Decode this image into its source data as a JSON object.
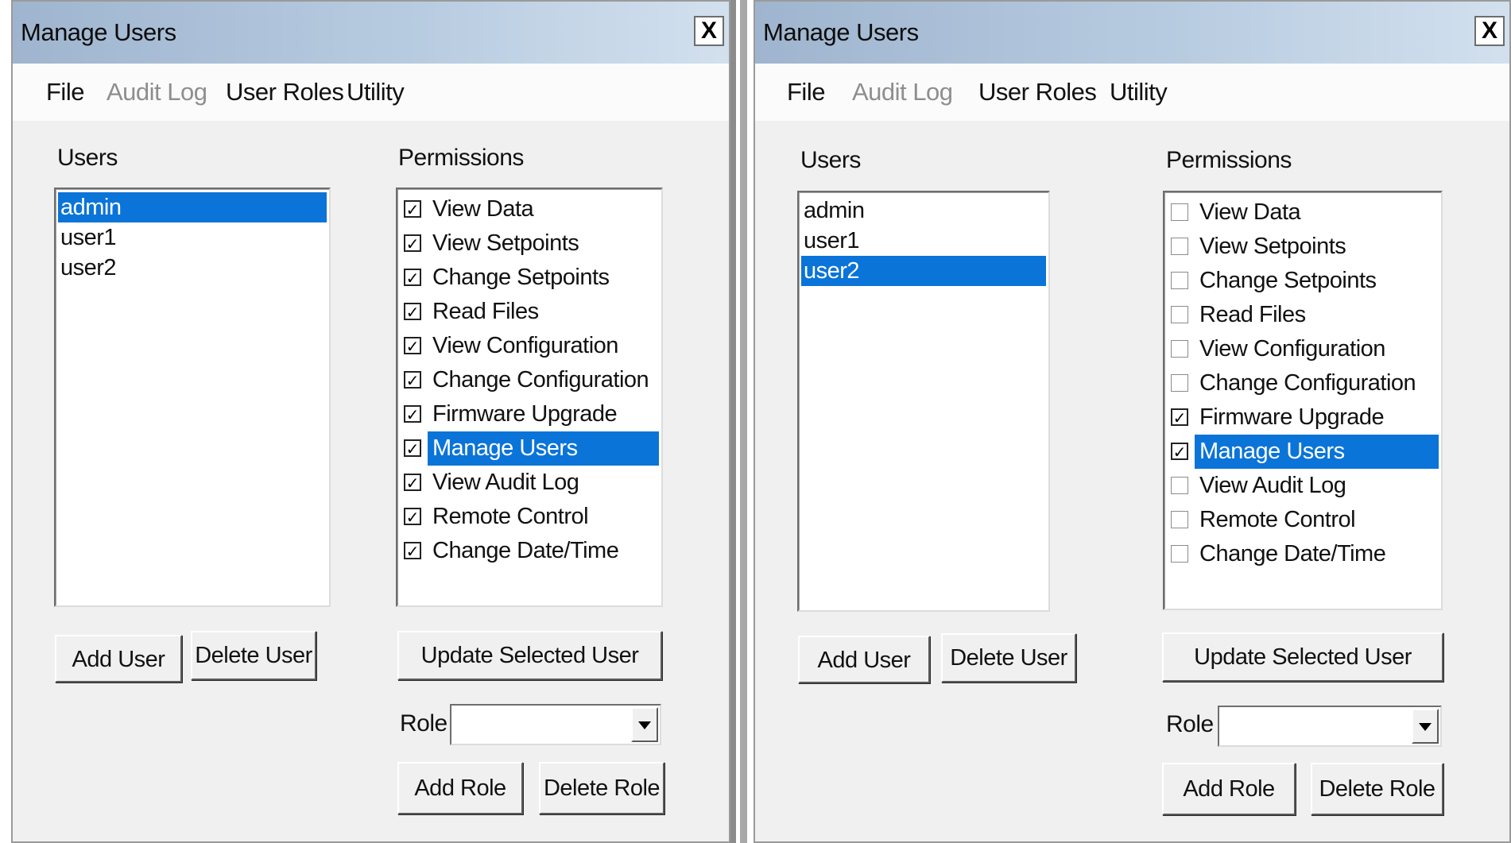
{
  "windows": [
    {
      "title": "Manage Users",
      "close_label": "X",
      "menu": [
        {
          "label": "File",
          "enabled": true
        },
        {
          "label": "Audit Log",
          "enabled": false
        },
        {
          "label": "User Roles",
          "enabled": true
        },
        {
          "label": "Utility",
          "enabled": true
        }
      ],
      "users_label": "Users",
      "users": [
        {
          "label": "admin",
          "selected": true
        },
        {
          "label": "user1",
          "selected": false
        },
        {
          "label": "user2",
          "selected": false
        }
      ],
      "permissions_label": "Permissions",
      "permissions": [
        {
          "label": "View Data",
          "checked": true,
          "selected": false
        },
        {
          "label": "View Setpoints",
          "checked": true,
          "selected": false
        },
        {
          "label": "Change Setpoints",
          "checked": true,
          "selected": false
        },
        {
          "label": "Read Files",
          "checked": true,
          "selected": false
        },
        {
          "label": "View Configuration",
          "checked": true,
          "selected": false
        },
        {
          "label": "Change Configuration",
          "checked": true,
          "selected": false
        },
        {
          "label": "Firmware Upgrade",
          "checked": true,
          "selected": false
        },
        {
          "label": "Manage Users",
          "checked": true,
          "selected": true
        },
        {
          "label": "View Audit Log",
          "checked": true,
          "selected": false
        },
        {
          "label": "Remote Control",
          "checked": true,
          "selected": false
        },
        {
          "label": "Change Date/Time",
          "checked": true,
          "selected": false
        }
      ],
      "add_user_label": "Add User",
      "delete_user_label": "Delete User",
      "update_label": "Update Selected User",
      "role_label": "Role",
      "role_value": "",
      "add_role_label": "Add Role",
      "delete_role_label": "Delete Role"
    },
    {
      "title": "Manage Users",
      "close_label": "X",
      "menu": [
        {
          "label": "File",
          "enabled": true
        },
        {
          "label": "Audit Log",
          "enabled": false
        },
        {
          "label": "User Roles",
          "enabled": true
        },
        {
          "label": "Utility",
          "enabled": true
        }
      ],
      "users_label": "Users",
      "users": [
        {
          "label": "admin",
          "selected": false
        },
        {
          "label": "user1",
          "selected": false
        },
        {
          "label": "user2",
          "selected": true
        }
      ],
      "permissions_label": "Permissions",
      "permissions": [
        {
          "label": "View Data",
          "checked": false,
          "selected": false
        },
        {
          "label": "View Setpoints",
          "checked": false,
          "selected": false
        },
        {
          "label": "Change Setpoints",
          "checked": false,
          "selected": false
        },
        {
          "label": "Read Files",
          "checked": false,
          "selected": false
        },
        {
          "label": "View Configuration",
          "checked": false,
          "selected": false
        },
        {
          "label": "Change Configuration",
          "checked": false,
          "selected": false
        },
        {
          "label": "Firmware Upgrade",
          "checked": true,
          "selected": false
        },
        {
          "label": "Manage Users",
          "checked": true,
          "selected": true
        },
        {
          "label": "View Audit Log",
          "checked": false,
          "selected": false
        },
        {
          "label": "Remote Control",
          "checked": false,
          "selected": false
        },
        {
          "label": "Change Date/Time",
          "checked": false,
          "selected": false
        }
      ],
      "add_user_label": "Add User",
      "delete_user_label": "Delete User",
      "update_label": "Update Selected User",
      "role_label": "Role",
      "role_value": "",
      "add_role_label": "Add Role",
      "delete_role_label": "Delete Role"
    }
  ],
  "colors": {
    "selection": "#0a74d8",
    "window_bg": "#f0f0f0",
    "title_gradient_start": "#9fb5cf",
    "title_gradient_end": "#d2e0ee",
    "disabled_text": "#8e8e8e"
  }
}
